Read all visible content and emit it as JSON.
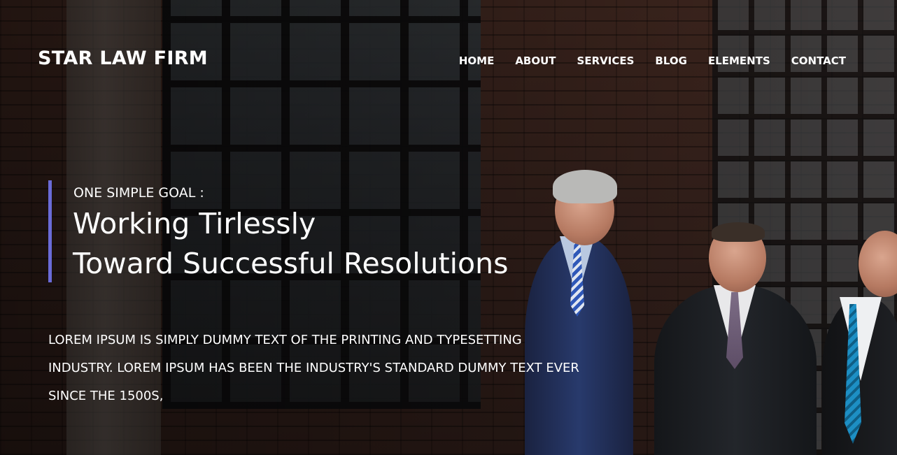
{
  "brand": {
    "name": "STAR LAW FIRM"
  },
  "nav": {
    "items": [
      {
        "label": "HOME"
      },
      {
        "label": "ABOUT"
      },
      {
        "label": "SERVICES"
      },
      {
        "label": "BLOG"
      },
      {
        "label": "ELEMENTS"
      },
      {
        "label": "CONTACT"
      }
    ]
  },
  "hero": {
    "kicker": "ONE SIMPLE GOAL :",
    "headline_line1": "Working Tirlessly",
    "headline_line2": "Toward Successful Resolutions",
    "body": "LOREM IPSUM IS SIMPLY DUMMY TEXT OF THE PRINTING AND TYPESETTING INDUSTRY. LOREM IPSUM HAS BEEN THE INDUSTRY'S STANDARD DUMMY TEXT EVER SINCE THE 1500S,"
  },
  "colors": {
    "accent": "#6a6bd8",
    "text": "#ffffff",
    "background": "#3a2620"
  }
}
